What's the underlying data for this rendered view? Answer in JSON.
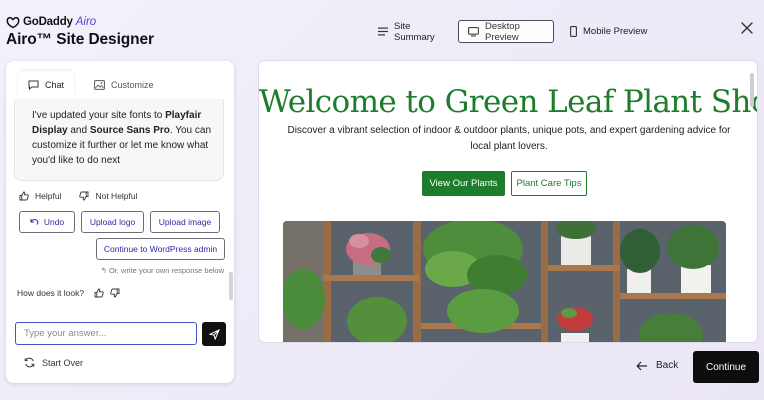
{
  "brand": {
    "logo_text": "GoDaddy",
    "airo_text": "Airo",
    "title": "Airo™ Site Designer"
  },
  "top_nav": {
    "site_summary": "Site Summary",
    "desktop_preview": "Desktop Preview",
    "mobile_preview": "Mobile Preview",
    "active": "desktop_preview"
  },
  "chat": {
    "tabs": [
      {
        "label": "Chat",
        "active": true
      },
      {
        "label": "Customize",
        "active": false
      }
    ],
    "message": {
      "pre": "I've updated your site fonts to ",
      "font1": "Playfair Display",
      "mid": " and ",
      "font2": "Source Sans Pro",
      "post": ". You can customize it further or let me know what you'd like to do next"
    },
    "helpful": "Helpful",
    "not_helpful": "Not Helpful",
    "actions": {
      "undo": "Undo",
      "upload_logo": "Upload logo",
      "upload_image": "Upload image",
      "continue_wp": "Continue to WordPress admin"
    },
    "hint": "Or, write your own response below",
    "looks_question": "How does it look?",
    "input_placeholder": "Type your answer...",
    "start_over": "Start Over"
  },
  "preview": {
    "title": "Welcome to Green Leaf Plant Shop",
    "subtitle": "Discover a vibrant selection of indoor & outdoor plants, unique pots, and expert gardening advice for local plant lovers.",
    "primary_cta": "View Our Plants",
    "secondary_cta": "Plant Care Tips",
    "accent_color": "#1e7d2d"
  },
  "footer": {
    "back": "Back",
    "continue": "Continue"
  }
}
